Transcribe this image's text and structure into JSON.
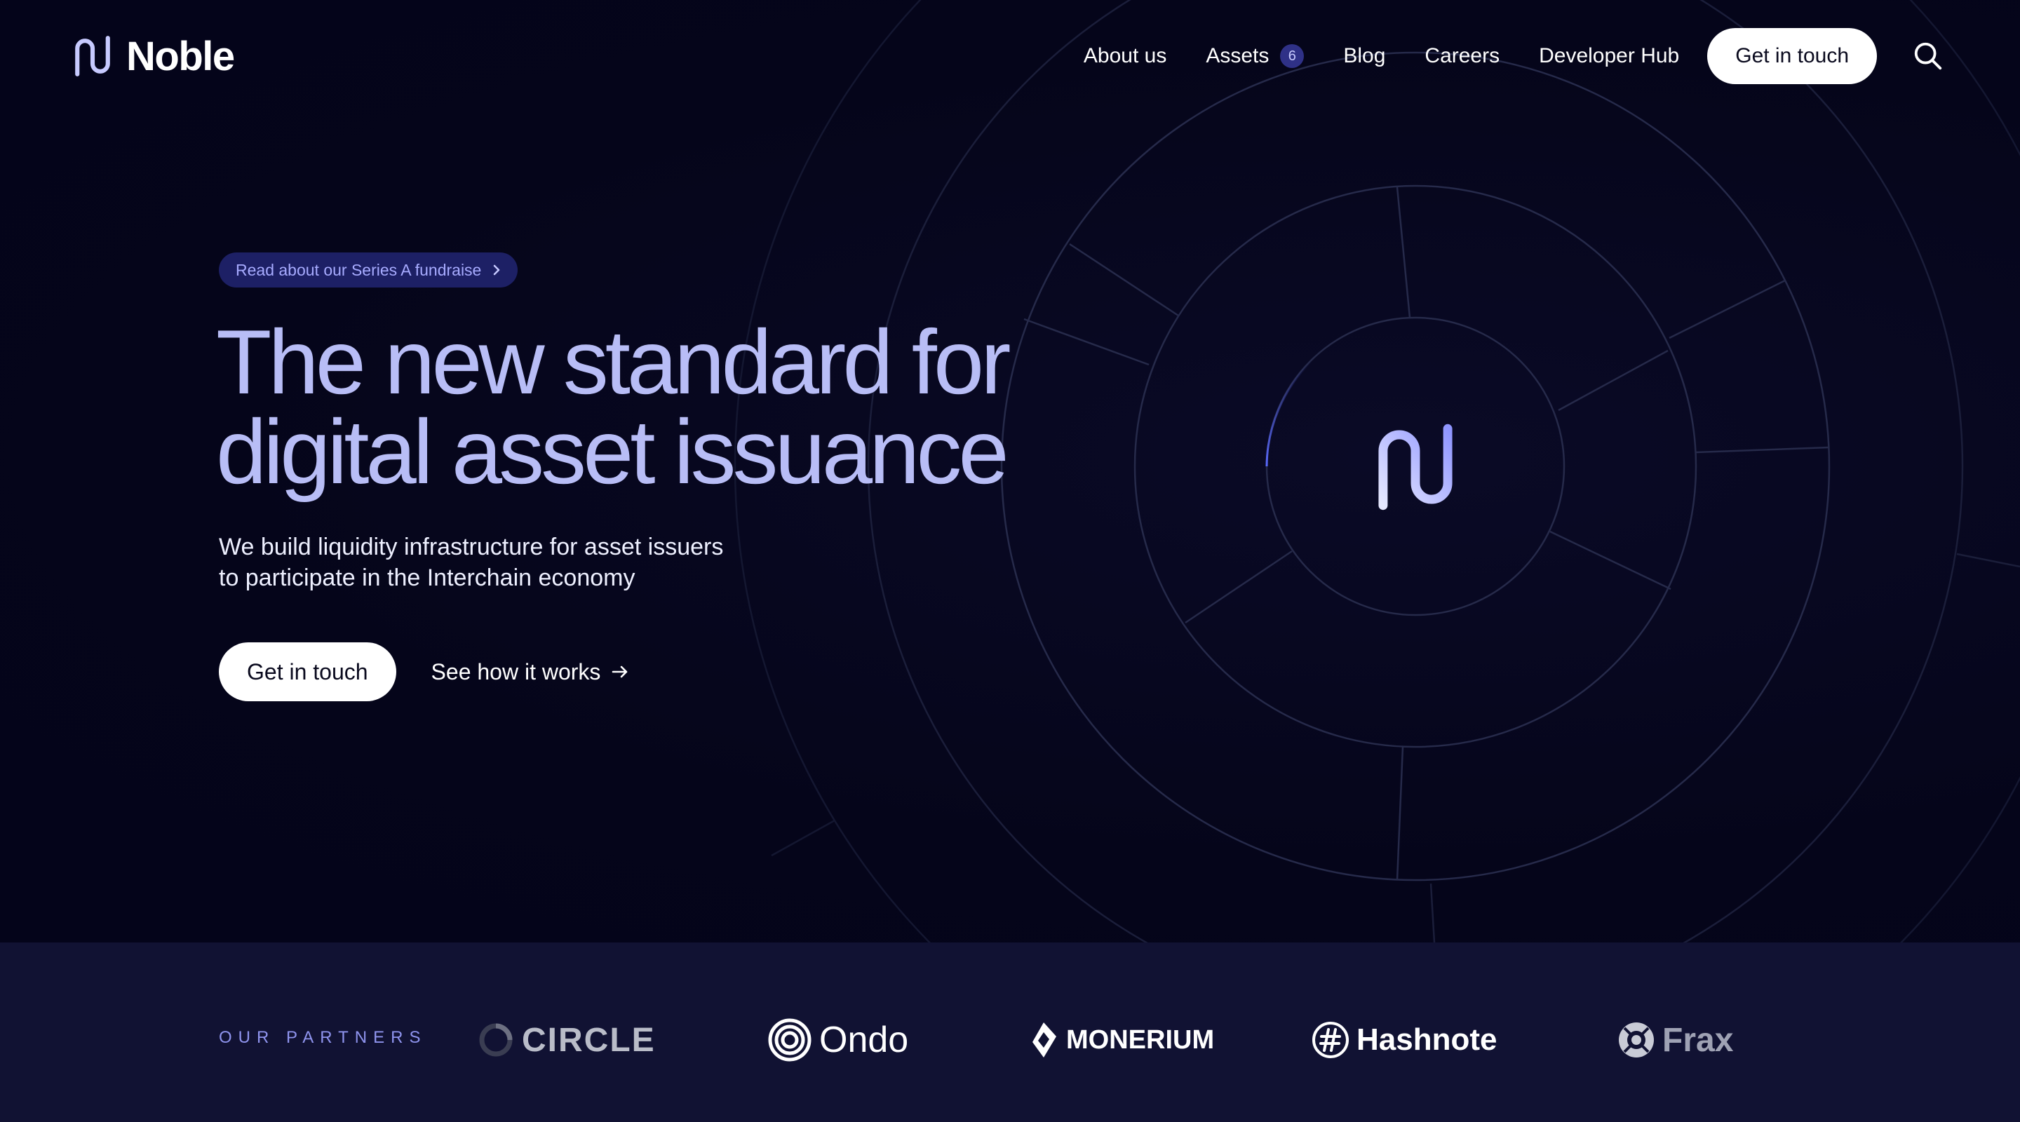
{
  "brand": {
    "name": "Noble"
  },
  "nav": {
    "items": [
      {
        "label": "About us"
      },
      {
        "label": "Assets",
        "badge": "6"
      },
      {
        "label": "Blog"
      },
      {
        "label": "Careers"
      },
      {
        "label": "Developer Hub"
      }
    ],
    "cta_label": "Get in touch",
    "search_icon": "search-icon"
  },
  "hero": {
    "announcement": "Read about our Series A fundraise",
    "headline_line1": "The new standard for",
    "headline_line2": "digital asset issuance",
    "subtext_line1": "We build liquidity infrastructure for asset issuers",
    "subtext_line2": "to participate in the Interchain economy",
    "primary_cta": "Get in touch",
    "secondary_cta": "See how it works"
  },
  "partners": {
    "label": "OUR PARTNERS",
    "logos": [
      {
        "name": "CIRCLE",
        "icon": "circle-logo-icon"
      },
      {
        "name": "Ondo",
        "icon": "ondo-logo-icon"
      },
      {
        "name": "MONERIUM",
        "icon": "monerium-logo-icon"
      },
      {
        "name": "Hashnote",
        "icon": "hashnote-logo-icon"
      },
      {
        "name": "Frax",
        "icon": "frax-logo-icon"
      }
    ]
  },
  "colors": {
    "background": "#05051a",
    "headline": "#b8bdf6",
    "accent": "#a7abff",
    "partners_bg": "#111233"
  }
}
